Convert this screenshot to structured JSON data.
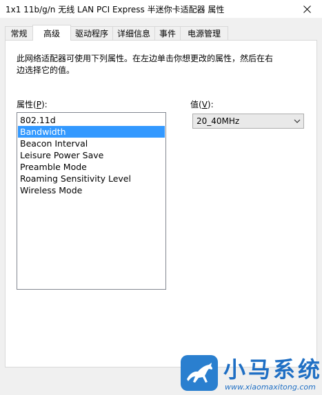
{
  "window": {
    "title": "1x1 11b/g/n 无线 LAN PCI Express 半迷你卡适配器 属性"
  },
  "tabs": [
    {
      "label": "常规"
    },
    {
      "label": "高级"
    },
    {
      "label": "驱动程序"
    },
    {
      "label": "详细信息"
    },
    {
      "label": "事件"
    },
    {
      "label": "电源管理"
    }
  ],
  "active_tab": "高级",
  "advanced": {
    "description": "此网络适配器可使用下列属性。在左边单击你想更改的属性，然后在右边选择它的值。",
    "property_label_prefix": "属性(",
    "property_label_key": "P",
    "property_label_suffix": "):",
    "value_label_prefix": "值(",
    "value_label_key": "V",
    "value_label_suffix": "):",
    "properties": [
      "802.11d",
      "Bandwidth",
      "Beacon Interval",
      "Leisure Power Save",
      "Preamble Mode",
      "Roaming Sensitivity Level",
      "Wireless Mode"
    ],
    "selected_property": "Bandwidth",
    "value": "20_40MHz"
  },
  "watermark": {
    "title": "小马系统",
    "url": "www.xiaomaxitong.com"
  },
  "colors": {
    "selection": "#3399ff",
    "watermark_blue": "#1f6fc4"
  },
  "icons": {
    "close": "close-icon",
    "dropdown": "chevron-down-icon",
    "logo": "horse-logo-icon"
  }
}
